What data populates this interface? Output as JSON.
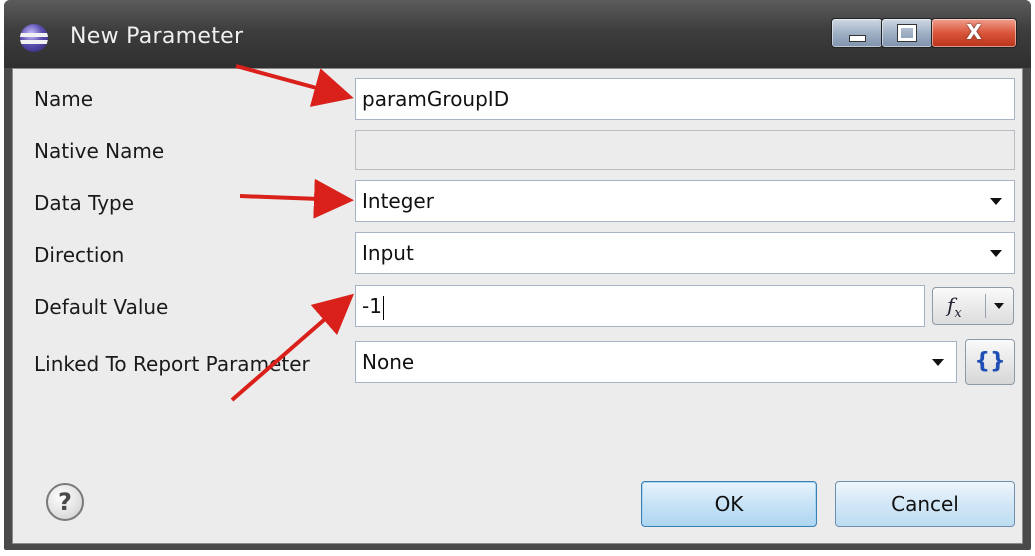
{
  "window": {
    "title": "New Parameter",
    "buttons": {
      "minimize": "minimize",
      "maximize": "maximize",
      "close": "X"
    }
  },
  "form": {
    "name_label": "Name",
    "name_value": "paramGroupID",
    "native_name_label": "Native Name",
    "native_name_value": "",
    "data_type_label": "Data Type",
    "data_type_value": "Integer",
    "direction_label": "Direction",
    "direction_value": "Input",
    "default_value_label": "Default Value",
    "default_value_value": "-1",
    "linked_label": "Linked To Report Parameter",
    "linked_value": "None"
  },
  "footer": {
    "help_glyph": "?",
    "ok_label": "OK",
    "cancel_label": "Cancel"
  },
  "icons": {
    "app": "eclipse-icon",
    "expression": "fx-icon",
    "binding": "braces-icon",
    "help": "help-icon"
  },
  "colors": {
    "annotation_arrow": "#d9201a",
    "titlebar": "#3d3d3d",
    "close_button": "#d9553a",
    "ok_button": "#c7e3f6"
  }
}
